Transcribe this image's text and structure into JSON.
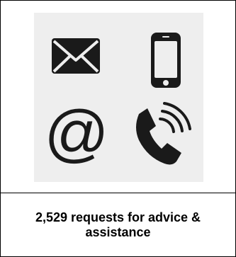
{
  "caption": {
    "text": "2,529 requests for advice & assistance"
  },
  "icons": [
    "envelope-icon",
    "mobile-phone-icon",
    "at-sign-icon",
    "phone-call-icon"
  ],
  "colors": {
    "icon": "#1a1a1a",
    "panel_background": "#eeeeee",
    "border": "#000000"
  }
}
